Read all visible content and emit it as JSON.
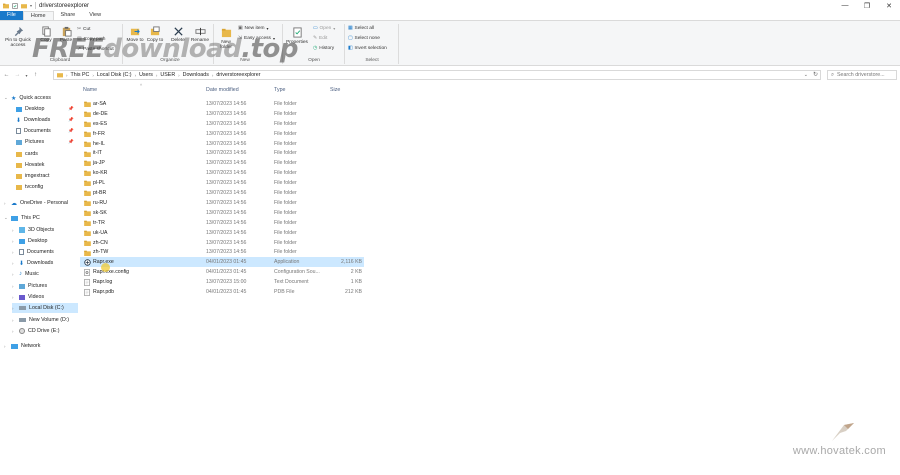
{
  "window": {
    "title": "driverstoreexplorer",
    "controls": [
      "—",
      "❐",
      "✕"
    ]
  },
  "ribbon_tabs": [
    "File",
    "Home",
    "Share",
    "View"
  ],
  "ribbon": {
    "pin_label": "Pin to Quick access",
    "copy_label": "Copy",
    "paste_label": "Paste",
    "cut_label": "Cut",
    "copy_path_label": "Copy path",
    "paste_shortcut_label": "Paste shortcut",
    "move_to_label": "Move to",
    "copy_to_label": "Copy to",
    "delete_label": "Delete",
    "rename_label": "Rename",
    "new_folder_label": "New folder",
    "new_item_label": "New item",
    "easy_access_label": "Easy access",
    "properties_label": "Properties",
    "open_label": "Open",
    "edit_label": "Edit",
    "history_label": "History",
    "select_all_label": "Select all",
    "select_none_label": "Select none",
    "invert_selection_label": "Invert selection",
    "group_clipboard": "Clipboard",
    "group_organize": "Organize",
    "group_new": "New",
    "group_open": "Open",
    "group_select": "Select"
  },
  "watermark": {
    "part1": "FREE",
    "part2": "download",
    "part3": ".top",
    "site": "www.hovatek.com"
  },
  "address": {
    "crumbs": [
      "This PC",
      "Local Disk (C:)",
      "Users",
      "USER",
      "Downloads",
      "driverstoreexplorer"
    ],
    "search_placeholder": "Search driverstore..."
  },
  "sidebar": {
    "items": [
      {
        "label": "Quick access",
        "icon": "star-icon"
      },
      {
        "label": "Desktop",
        "icon": "desktop-icon"
      },
      {
        "label": "Downloads",
        "icon": "download-icon"
      },
      {
        "label": "Documents",
        "icon": "document-icon"
      },
      {
        "label": "Pictures",
        "icon": "pictures-icon"
      },
      {
        "label": "cards",
        "icon": "folder-icon"
      },
      {
        "label": "Hovatek",
        "icon": "folder-icon"
      },
      {
        "label": "imgextract",
        "icon": "folder-icon"
      },
      {
        "label": "tvconfig",
        "icon": "folder-icon"
      },
      {
        "label": "OneDrive - Personal",
        "icon": "cloud-icon"
      },
      {
        "label": "This PC",
        "icon": "computer-icon"
      },
      {
        "label": "3D Objects",
        "icon": "cube-icon"
      },
      {
        "label": "Desktop",
        "icon": "desktop-icon"
      },
      {
        "label": "Documents",
        "icon": "document-icon"
      },
      {
        "label": "Downloads",
        "icon": "download-icon"
      },
      {
        "label": "Music",
        "icon": "music-icon"
      },
      {
        "label": "Pictures",
        "icon": "pictures-icon"
      },
      {
        "label": "Videos",
        "icon": "video-icon"
      },
      {
        "label": "Local Disk (C:)",
        "icon": "drive-icon"
      },
      {
        "label": "New Volume (D:)",
        "icon": "drive-icon"
      },
      {
        "label": "CD Drive (E:)",
        "icon": "cd-icon"
      },
      {
        "label": "Network",
        "icon": "network-icon"
      }
    ]
  },
  "columns": {
    "name": "Name",
    "date": "Date modified",
    "type": "Type",
    "size": "Size"
  },
  "files": [
    {
      "name": "ar-SA",
      "date": "13/07/2023 14:56",
      "type": "File folder",
      "size": "",
      "kind": "folder"
    },
    {
      "name": "de-DE",
      "date": "13/07/2023 14:56",
      "type": "File folder",
      "size": "",
      "kind": "folder"
    },
    {
      "name": "es-ES",
      "date": "13/07/2023 14:56",
      "type": "File folder",
      "size": "",
      "kind": "folder"
    },
    {
      "name": "fr-FR",
      "date": "13/07/2023 14:56",
      "type": "File folder",
      "size": "",
      "kind": "folder"
    },
    {
      "name": "he-IL",
      "date": "13/07/2023 14:56",
      "type": "File folder",
      "size": "",
      "kind": "folder"
    },
    {
      "name": "it-IT",
      "date": "13/07/2023 14:56",
      "type": "File folder",
      "size": "",
      "kind": "folder"
    },
    {
      "name": "ja-JP",
      "date": "13/07/2023 14:56",
      "type": "File folder",
      "size": "",
      "kind": "folder"
    },
    {
      "name": "ko-KR",
      "date": "13/07/2023 14:56",
      "type": "File folder",
      "size": "",
      "kind": "folder"
    },
    {
      "name": "pl-PL",
      "date": "13/07/2023 14:56",
      "type": "File folder",
      "size": "",
      "kind": "folder"
    },
    {
      "name": "pt-BR",
      "date": "13/07/2023 14:56",
      "type": "File folder",
      "size": "",
      "kind": "folder"
    },
    {
      "name": "ru-RU",
      "date": "13/07/2023 14:56",
      "type": "File folder",
      "size": "",
      "kind": "folder"
    },
    {
      "name": "sk-SK",
      "date": "13/07/2023 14:56",
      "type": "File folder",
      "size": "",
      "kind": "folder"
    },
    {
      "name": "tr-TR",
      "date": "13/07/2023 14:56",
      "type": "File folder",
      "size": "",
      "kind": "folder"
    },
    {
      "name": "uk-UA",
      "date": "13/07/2023 14:56",
      "type": "File folder",
      "size": "",
      "kind": "folder"
    },
    {
      "name": "zh-CN",
      "date": "13/07/2023 14:56",
      "type": "File folder",
      "size": "",
      "kind": "folder"
    },
    {
      "name": "zh-TW",
      "date": "13/07/2023 14:56",
      "type": "File folder",
      "size": "",
      "kind": "folder"
    },
    {
      "name": "Rapr.exe",
      "date": "04/01/2023 01:45",
      "type": "Application",
      "size": "2,116 KB",
      "kind": "app"
    },
    {
      "name": "Rapr.exe.config",
      "date": "04/01/2023 01:45",
      "type": "Configuration Sou...",
      "size": "2 KB",
      "kind": "config"
    },
    {
      "name": "Rapr.log",
      "date": "13/07/2023 15:00",
      "type": "Text Document",
      "size": "1 KB",
      "kind": "text"
    },
    {
      "name": "Rapr.pdb",
      "date": "04/01/2023 01:45",
      "type": "PDB File",
      "size": "212 KB",
      "kind": "text"
    }
  ],
  "colors": {
    "accent": "#1979ca",
    "selection": "#cce8ff",
    "folder": "#e8b84a"
  }
}
